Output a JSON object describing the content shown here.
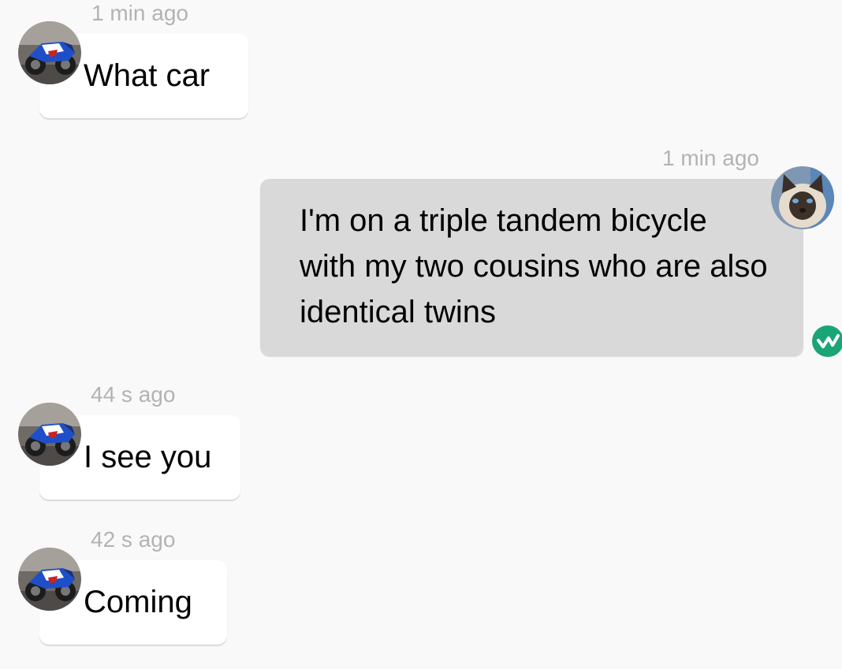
{
  "messages": [
    {
      "direction": "incoming",
      "time": "1 min ago",
      "text": "What car",
      "avatar": "motorcycle-avatar"
    },
    {
      "direction": "outgoing",
      "time": "1 min ago",
      "lines": [
        "I'm on a triple tandem bicycle",
        "with my two cousins who are also",
        "identical twins"
      ],
      "avatar": "cat-avatar",
      "status_icon": "read-check-icon"
    },
    {
      "direction": "incoming",
      "time": "44 s ago",
      "text": "I see you",
      "avatar": "motorcycle-avatar"
    },
    {
      "direction": "incoming",
      "time": "42 s ago",
      "text": "Coming",
      "avatar": "motorcycle-avatar"
    }
  ],
  "colors": {
    "background": "#f9f9f9",
    "incoming_bubble": "#ffffff",
    "outgoing_bubble": "#d9d9d9",
    "timestamp": "#b3b3b3",
    "status_green": "#1aa576"
  }
}
